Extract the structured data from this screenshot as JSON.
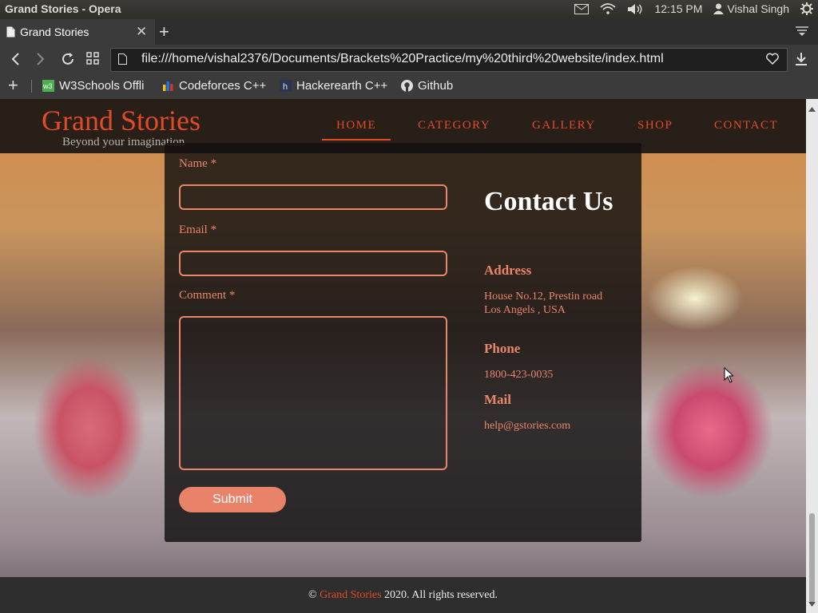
{
  "os": {
    "window_title": "Grand Stories - Opera",
    "time": "12:15 PM",
    "user": "Vishal Singh"
  },
  "browser": {
    "tab_title": "Grand Stories",
    "url": "file:///home/vishal2376/Documents/Brackets%20Practice/my%20third%20website/index.html",
    "bookmarks": [
      {
        "label": "W3Schools Offli",
        "icon": "w3schools-icon"
      },
      {
        "label": "Codeforces C++",
        "icon": "codeforces-icon"
      },
      {
        "label": "Hackerearth C++",
        "icon": "hackerearth-icon"
      },
      {
        "label": "Github",
        "icon": "github-icon"
      }
    ]
  },
  "site": {
    "brand": "Grand Stories",
    "tagline": "Beyond your imagination",
    "nav": [
      "HOME",
      "CATEGORY",
      "GALLERY",
      "SHOP",
      "CONTACT"
    ],
    "active_nav": "HOME",
    "accent_color": "#e34a26",
    "form_color": "#e8866a"
  },
  "form": {
    "name_label": "Name *",
    "email_label": "Email *",
    "comment_label": "Comment *",
    "submit_label": "Submit"
  },
  "contact": {
    "title": "Contact Us",
    "address_heading": "Address",
    "address_line1": "House No.12, Prestin road",
    "address_line2": "Los Angels , USA",
    "phone_heading": "Phone",
    "phone": "1800-423-0035",
    "mail_heading": "Mail",
    "mail": "help@gstories.com"
  },
  "footer": {
    "prefix": "©",
    "brand": "Grand Stories",
    "suffix": "2020. All rights reserved."
  }
}
